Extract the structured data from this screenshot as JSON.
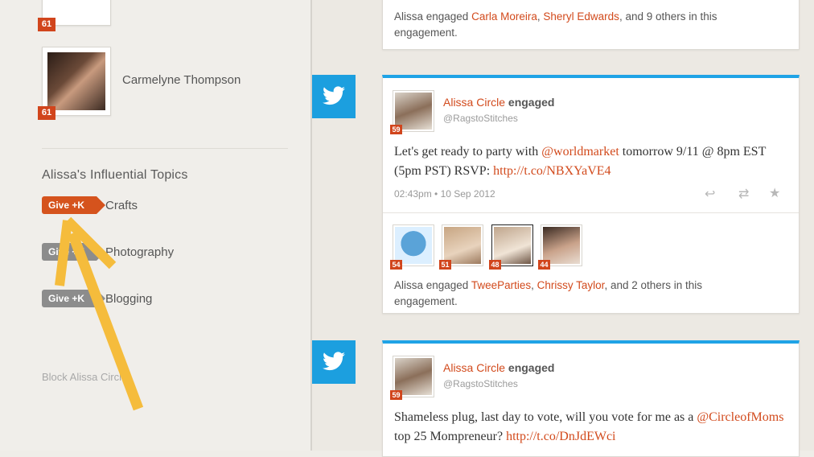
{
  "sidebar": {
    "users": [
      {
        "name": "",
        "score": "61"
      },
      {
        "name": "Carmelyne Thompson",
        "score": "61"
      }
    ],
    "section_title": "Alissa's Influential Topics",
    "give_label": "Give +K",
    "topics": [
      {
        "label": "Crafts",
        "active": true
      },
      {
        "label": "Photography",
        "active": false
      },
      {
        "label": "Blogging",
        "active": false
      }
    ],
    "block_link": "Block Alissa Circle"
  },
  "feed": {
    "card0": {
      "engaged_prefix": "Alissa engaged",
      "names": [
        "Carla Moreira",
        "Sheryl Edwards"
      ],
      "suffix": ", and 9 others in this",
      "suffix2": "engagement."
    },
    "card1": {
      "author": "Alissa Circle",
      "action": "engaged",
      "handle": "@RagstoStitches",
      "score": "59",
      "tweet_pre": "Let's get ready to party with ",
      "mention": "@worldmarket",
      "tweet_mid": " tomorrow 9/11 @ 8pm EST (5pm PST) RSVP: ",
      "link": "http://t.co/NBXYaVE4",
      "timestamp": "02:43pm • 10 Sep 2012",
      "engagers": [
        {
          "score": "54"
        },
        {
          "score": "51"
        },
        {
          "score": "48"
        },
        {
          "score": "44"
        }
      ],
      "engaged_prefix": "Alissa engaged",
      "names": [
        "TweeParties",
        "Chrissy Taylor"
      ],
      "suffix": ", and 2 others in this",
      "suffix2": "engagement."
    },
    "card2": {
      "author": "Alissa Circle",
      "action": "engaged",
      "handle": "@RagstoStitches",
      "score": "59",
      "tweet_pre": "Shameless plug, last day to vote, will you vote for me as a ",
      "mention": "@CircleofMoms",
      "tweet_mid": " top 25 Mompreneur? ",
      "link": "http://t.co/DnJdEWci"
    }
  },
  "colors": {
    "accent": "#d24a1c",
    "twitter": "#1c9fdf",
    "arrow": "#f5bc3c"
  }
}
